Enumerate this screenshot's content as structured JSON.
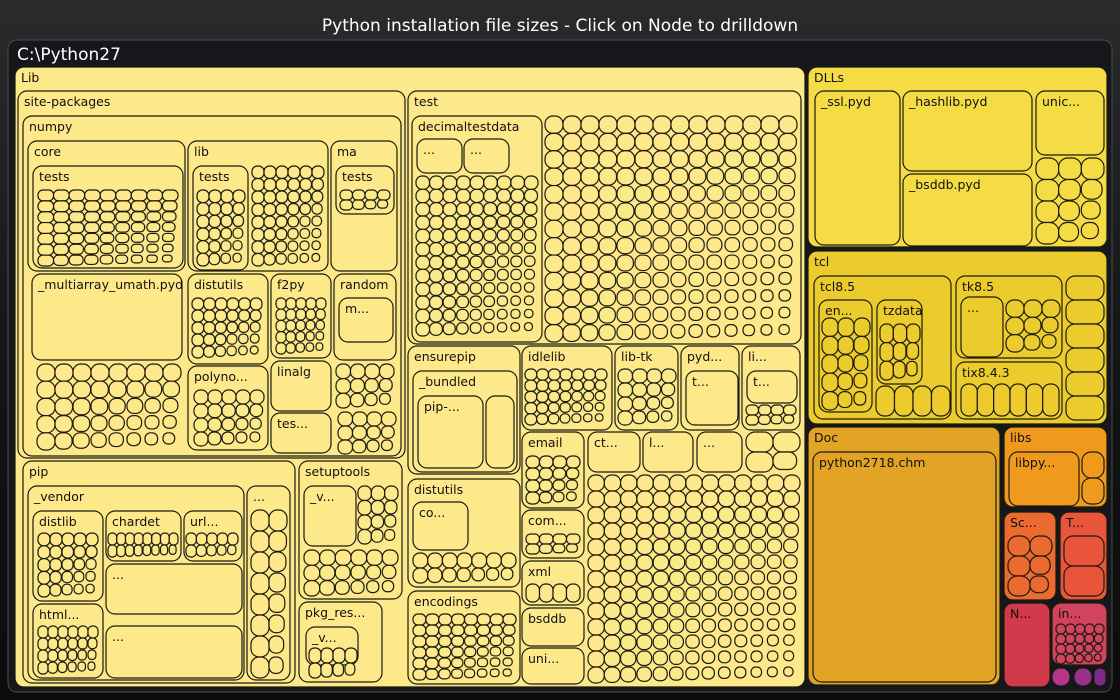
{
  "chart_data": {
    "type": "treemap",
    "title": "Python installation file sizes - Click on Node to drilldown",
    "root": "C:\\Python27",
    "colors": {
      "Lib": "#fde98a",
      "DLLs": "#f5dc45",
      "tcl": "#ebcc2c",
      "Doc": "#e3a324",
      "libs": "#ef9a1c",
      "Scripts": "#ea6a30",
      "Tools": "#e9553a",
      "NEWS": "#d13a4a",
      "include": "#d2445e",
      "misc1": "#b33786",
      "misc2": "#9a2f8d",
      "misc3": "#7e2a8c"
    },
    "nodes": [
      {
        "label": "Lib"
      },
      {
        "label": "site-packages"
      },
      {
        "label": "numpy"
      },
      {
        "label": "core"
      },
      {
        "label": "tests"
      },
      {
        "label": "lib"
      },
      {
        "label": "tests"
      },
      {
        "label": "ma"
      },
      {
        "label": "tests"
      },
      {
        "label": "_multiarray_umath.pyd"
      },
      {
        "label": "distutils"
      },
      {
        "label": "f2py"
      },
      {
        "label": "random"
      },
      {
        "label": "m..."
      },
      {
        "label": "polyno..."
      },
      {
        "label": "linalg"
      },
      {
        "label": "tes..."
      },
      {
        "label": "pip"
      },
      {
        "label": "_vendor"
      },
      {
        "label": "distlib"
      },
      {
        "label": "chardet"
      },
      {
        "label": "url..."
      },
      {
        "label": "..."
      },
      {
        "label": "html..."
      },
      {
        "label": "..."
      },
      {
        "label": "..."
      },
      {
        "label": "setuptools"
      },
      {
        "label": "_v..."
      },
      {
        "label": "pkg_res..."
      },
      {
        "label": "_v..."
      },
      {
        "label": "test"
      },
      {
        "label": "decimaltestdata"
      },
      {
        "label": "..."
      },
      {
        "label": "..."
      },
      {
        "label": "ensurepip"
      },
      {
        "label": "_bundled"
      },
      {
        "label": "pip-..."
      },
      {
        "label": "idlelib"
      },
      {
        "label": "lib-tk"
      },
      {
        "label": "pyd..."
      },
      {
        "label": "t..."
      },
      {
        "label": "li..."
      },
      {
        "label": "t..."
      },
      {
        "label": "distutils"
      },
      {
        "label": "co..."
      },
      {
        "label": "encodings"
      },
      {
        "label": "email"
      },
      {
        "label": "ct..."
      },
      {
        "label": "l..."
      },
      {
        "label": "..."
      },
      {
        "label": "com..."
      },
      {
        "label": "xml"
      },
      {
        "label": "bsddb"
      },
      {
        "label": "uni..."
      },
      {
        "label": "DLLs"
      },
      {
        "label": "_ssl.pyd"
      },
      {
        "label": "_hashlib.pyd"
      },
      {
        "label": "unic..."
      },
      {
        "label": "_bsddb.pyd"
      },
      {
        "label": "tcl"
      },
      {
        "label": "tcl8.5"
      },
      {
        "label": "en..."
      },
      {
        "label": "tzdata"
      },
      {
        "label": "tk8.5"
      },
      {
        "label": "..."
      },
      {
        "label": "tix8.4.3"
      },
      {
        "label": "Doc"
      },
      {
        "label": "python2718.chm"
      },
      {
        "label": "libs"
      },
      {
        "label": "libpy..."
      },
      {
        "label": "Sc..."
      },
      {
        "label": "T..."
      },
      {
        "label": "N..."
      },
      {
        "label": "in..."
      }
    ]
  }
}
